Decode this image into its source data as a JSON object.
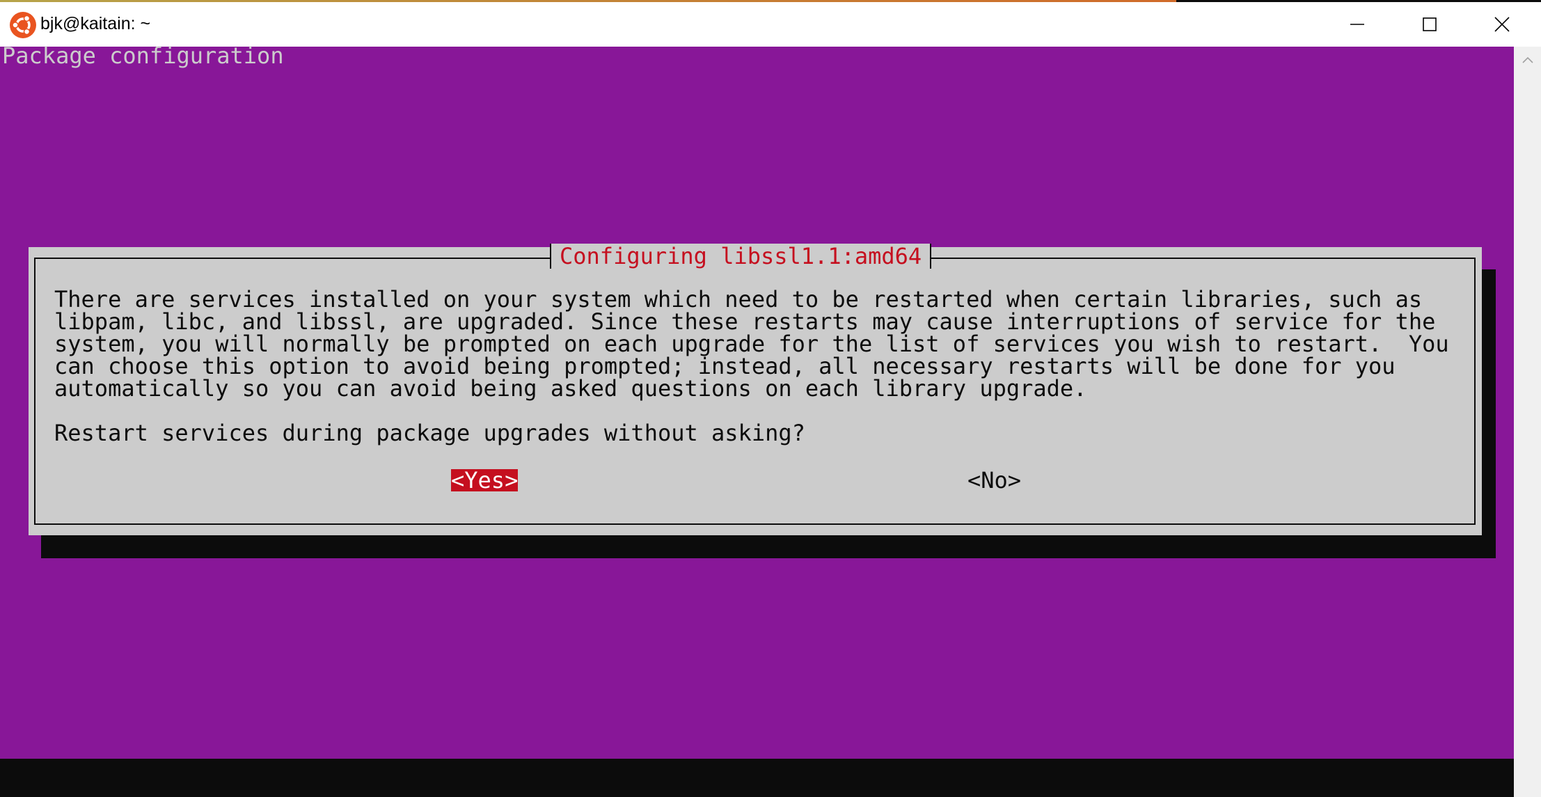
{
  "window": {
    "title": "bjk@kaitain: ~",
    "icon": "ubuntu-icon"
  },
  "terminal": {
    "header": "Package configuration"
  },
  "dialog": {
    "title": "Configuring libssl1.1:amd64",
    "lines": [
      "There are services installed on your system which need to be restarted when certain libraries, such as",
      "libpam, libc, and libssl, are upgraded. Since these restarts may cause interruptions of service for the",
      "system, you will normally be prompted on each upgrade for the list of services you wish to restart.  You",
      "can choose this option to avoid being prompted; instead, all necessary restarts will be done for you",
      "automatically so you can avoid being asked questions on each library upgrade."
    ],
    "question": "Restart services during package upgrades without asking?",
    "yes_label": "<Yes>",
    "no_label": "<No>"
  },
  "colors": {
    "terminal_bg": "#881798",
    "dialog_bg": "#cccccc",
    "accent": "#c50f1f",
    "text": "#0c0c0c"
  }
}
